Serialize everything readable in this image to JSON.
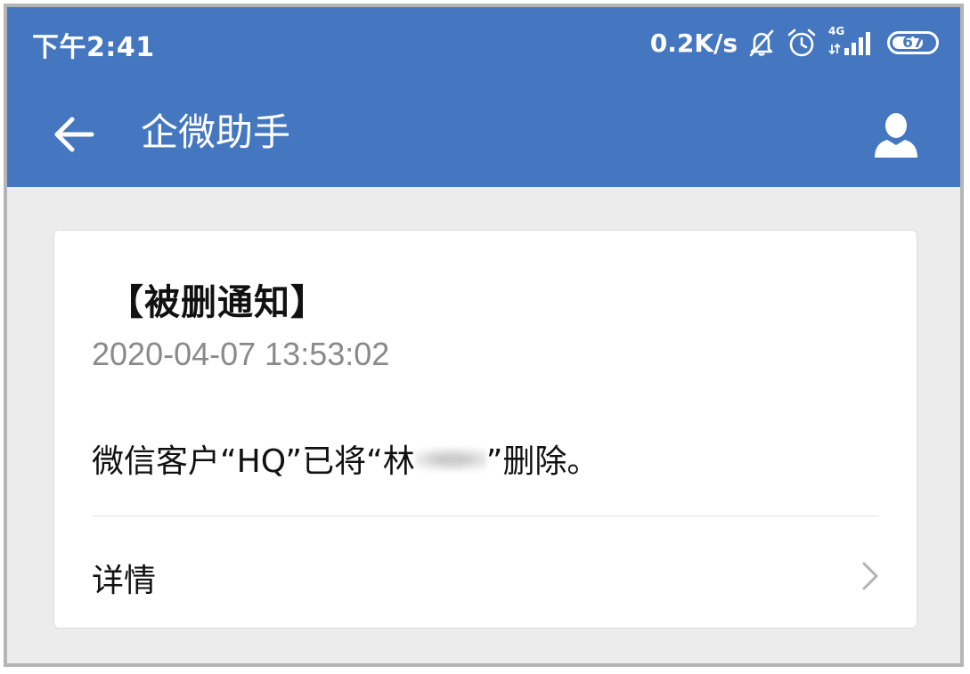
{
  "status_bar": {
    "time": "下午2:41",
    "net_speed": "0.2K/s",
    "network_type": "4G",
    "battery": "67",
    "icons": [
      "bell-off-icon",
      "alarm-clock-icon",
      "signal-icon",
      "battery-icon"
    ]
  },
  "app_bar": {
    "title": "企微助手",
    "back_icon": "arrow-left-icon",
    "profile_icon": "person-icon"
  },
  "notification": {
    "title": "【被删通知】",
    "timestamp": "2020-04-07 13:53:02",
    "message_prefix": "微信客户“HQ”已将“林",
    "message_suffix": "”删除。",
    "details_label": "详情",
    "details_icon": "chevron-right-icon"
  },
  "colors": {
    "primary": "#4477c0",
    "background": "#ececec",
    "card": "#ffffff",
    "muted_text": "#8a8a8a"
  }
}
